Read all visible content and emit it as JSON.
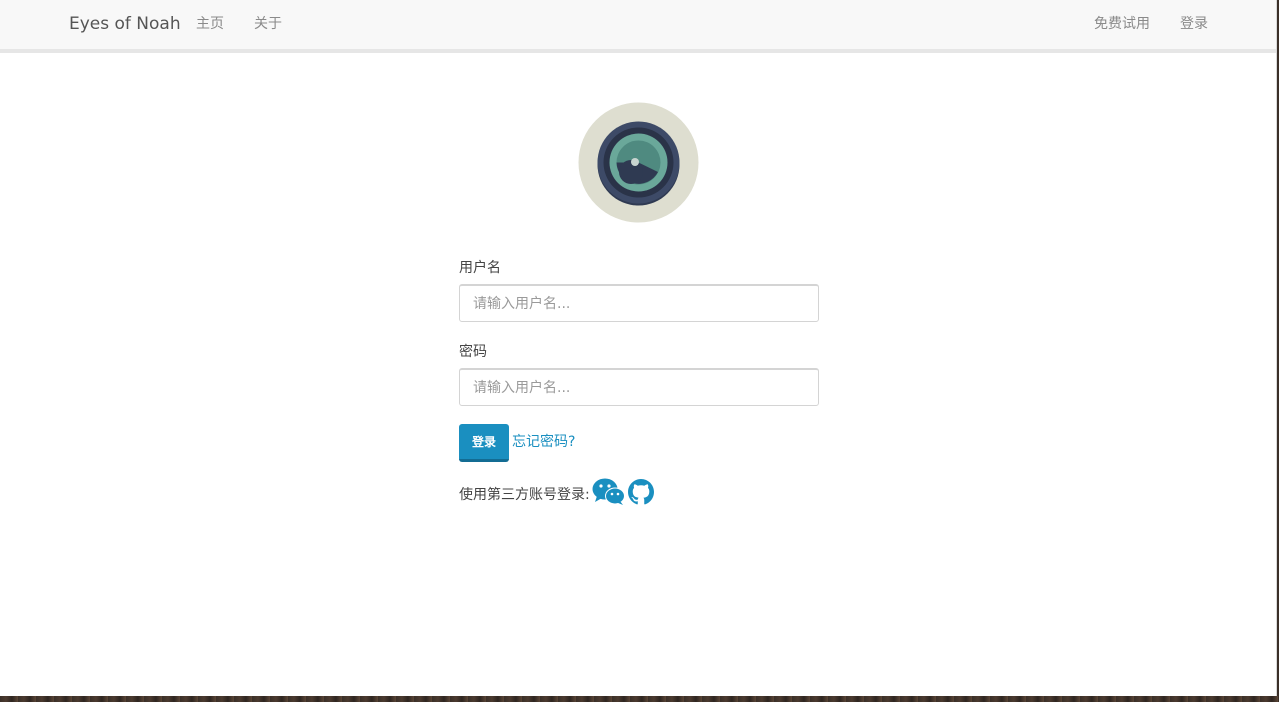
{
  "navbar": {
    "brand": "Eyes of Noah",
    "left_items": [
      {
        "label": "主页"
      },
      {
        "label": "关于"
      }
    ],
    "right_items": [
      {
        "label": "免费试用"
      },
      {
        "label": "登录"
      }
    ]
  },
  "logo": {
    "icon": "camera-lens-icon",
    "colors": {
      "outer": "#deded0",
      "rim": "#3d4a67",
      "lens": "#6aa89a",
      "highlight": "#c8d4d0"
    }
  },
  "form": {
    "username": {
      "label": "用户名",
      "placeholder": "请输入用户名...",
      "value": ""
    },
    "password": {
      "label": "密码",
      "placeholder": "请输入用户名...",
      "value": ""
    },
    "submit_label": "登录",
    "forgot_label": "忘记密码?"
  },
  "third_party": {
    "label": "使用第三方账号登录:",
    "providers": [
      {
        "icon": "wechat-icon"
      },
      {
        "icon": "github-icon"
      }
    ]
  },
  "colors": {
    "accent": "#1a8fc0",
    "navbar_bg": "#f8f8f8",
    "nav_text": "#8a8a8a"
  }
}
